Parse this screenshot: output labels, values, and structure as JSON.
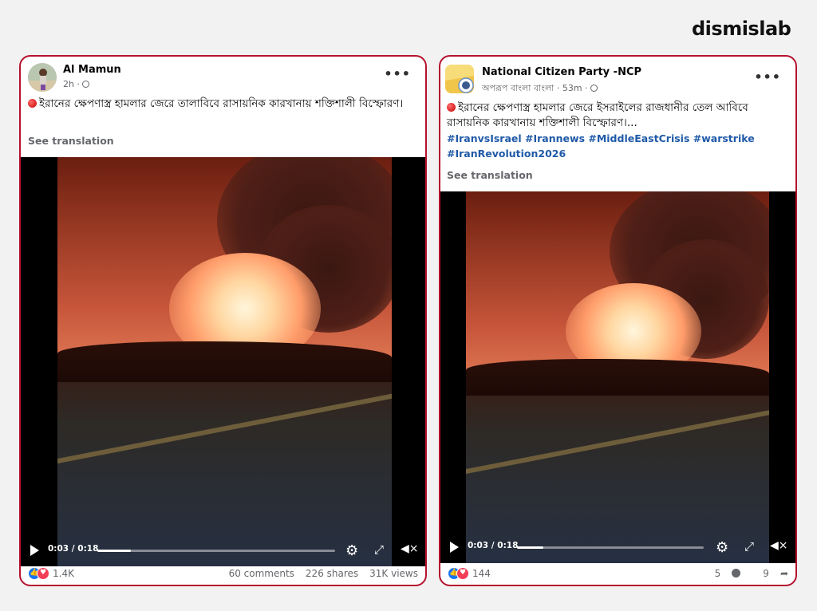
{
  "brand": {
    "logo_text": "dismislab"
  },
  "posts": [
    {
      "author": "Al Mamun",
      "meta": "2h ·",
      "text": "ইরানের ক্ষেপণাস্ত্র হামলার জেরে তালাবিবে রাসায়নিক কারখানায় শক্তিশালী বিস্ফোরণ।",
      "hashtags": "",
      "see_translation": "See translation",
      "video": {
        "current_time": "0:03",
        "duration": "0:18",
        "progress": 0.14
      },
      "reaction_count": "1.4K",
      "comments": "60 comments",
      "shares": "226 shares",
      "views": "31K views"
    },
    {
      "author": "National Citizen Party -NCP",
      "meta": "অপরূপ বাংলা বাংলা · 53m ·",
      "text": "ইরানের ক্ষেপণাস্ত্র হামলার জেরে  ইসরাইলের রাজধানীর তেল আবিবে রাসায়নিক কারখানায় শক্তিশালী বিস্ফোরণ।...",
      "hashtags": "#IranvsIsrael #Irannews #MiddleEastCrisis #warstrike #IranRevolution2026",
      "see_translation": "See translation",
      "video": {
        "current_time": "0:03",
        "duration": "0:18",
        "progress": 0.14
      },
      "reaction_count": "144",
      "comments": "5",
      "shares": "9"
    }
  ],
  "icons": {
    "more": "more-options-icon",
    "globe": "globe-icon",
    "play": "play-icon",
    "settings": "gear-icon",
    "fullscreen": "expand-icon",
    "volume": "volume-muted-icon",
    "like": "like-reaction-icon",
    "love": "love-reaction-icon",
    "comment": "comment-icon",
    "share": "share-icon"
  }
}
